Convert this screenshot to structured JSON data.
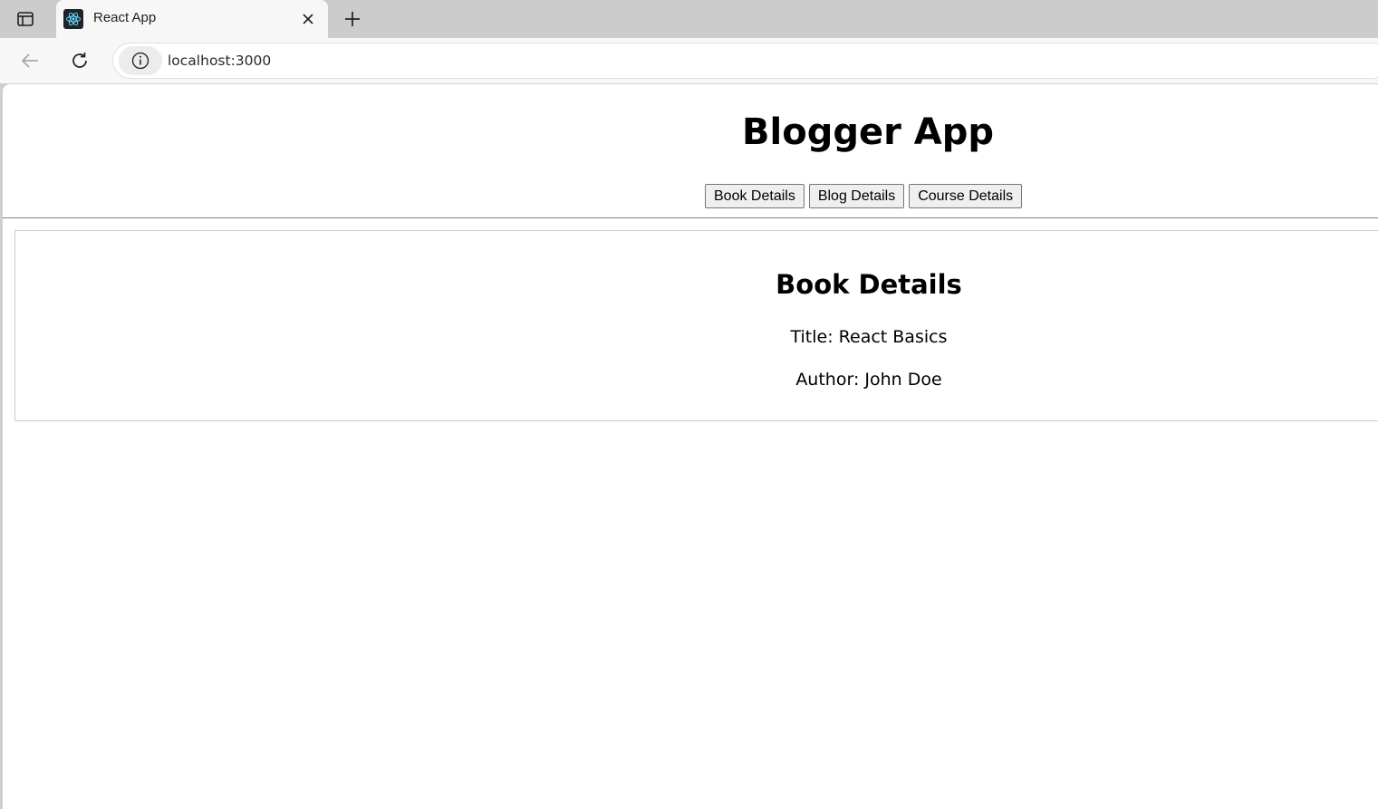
{
  "browser": {
    "tab": {
      "title": "React App"
    },
    "address_bar": {
      "url": "localhost:3000"
    },
    "icons": {
      "tab_actions": "tab-actions-icon",
      "favicon": "react-logo-icon",
      "close": "close-icon",
      "new_tab": "plus-icon",
      "back": "back-arrow-icon",
      "reload": "reload-icon",
      "site_info": "info-icon"
    }
  },
  "app": {
    "title": "Blogger App",
    "nav": {
      "book_label": "Book Details",
      "blog_label": "Blog Details",
      "course_label": "Course Details"
    },
    "content": {
      "heading": "Book Details",
      "title_line": "Title: React Basics",
      "author_line": "Author: John Doe"
    }
  },
  "colors": {
    "tabstrip": "#cccccc",
    "toolbar": "#f7f7f7",
    "react_accent": "#61dafb"
  }
}
